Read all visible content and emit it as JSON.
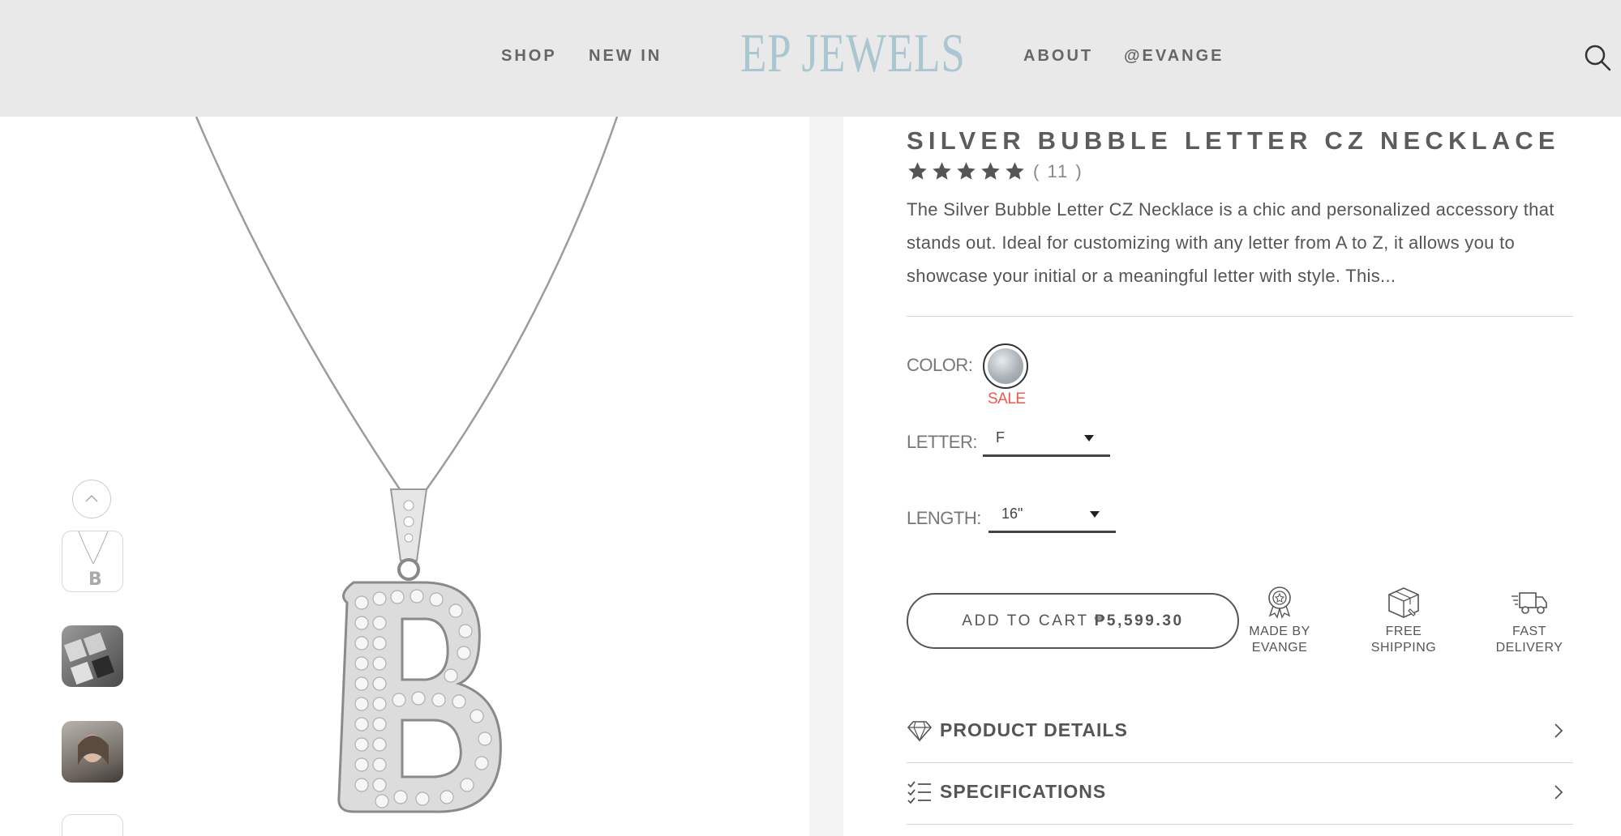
{
  "header": {
    "nav_left": [
      "SHOP",
      "NEW IN"
    ],
    "logo": "EP JEWELS",
    "nav_right": [
      "ABOUT",
      "@EVANGE"
    ],
    "search_icon": "search-icon"
  },
  "gallery": {
    "thumbnails": [
      "product-thumb-necklace",
      "product-thumb-packaging",
      "product-thumb-model",
      "product-thumb-partial"
    ],
    "scroll_up_icon": "chevron-up-icon"
  },
  "product": {
    "title": "SILVER BUBBLE LETTER CZ NECKLACE",
    "rating": 5,
    "review_count": "( 11 )",
    "description": "The Silver Bubble Letter CZ Necklace is a chic and personalized accessory that stands out. Ideal for customizing with any letter from A to Z, it allows you to showcase your initial or a meaningful letter with style. This...",
    "color_label": "COLOR:",
    "color_swatch": "silver",
    "color_tag": "SALE",
    "letter_label": "LETTER:",
    "letter_value": "F",
    "length_label": "LENGTH:",
    "length_value": "16\"",
    "cart_label": "ADD TO CART",
    "price": "₱5,599.30"
  },
  "features": [
    {
      "icon": "award-badge-icon",
      "line1": "MADE BY",
      "line2": "EVANGE"
    },
    {
      "icon": "package-box-icon",
      "line1": "FREE",
      "line2": "SHIPPING"
    },
    {
      "icon": "delivery-truck-icon",
      "line1": "FAST",
      "line2": "DELIVERY"
    }
  ],
  "accordion": [
    {
      "icon": "diamond-icon",
      "label": "PRODUCT DETAILS"
    },
    {
      "icon": "checklist-icon",
      "label": "SPECIFICATIONS"
    }
  ],
  "colors": {
    "header_bg": "#e9e9e9",
    "logo": "#a9c6d1",
    "sale": "#ee5a4e",
    "text": "#555555"
  }
}
